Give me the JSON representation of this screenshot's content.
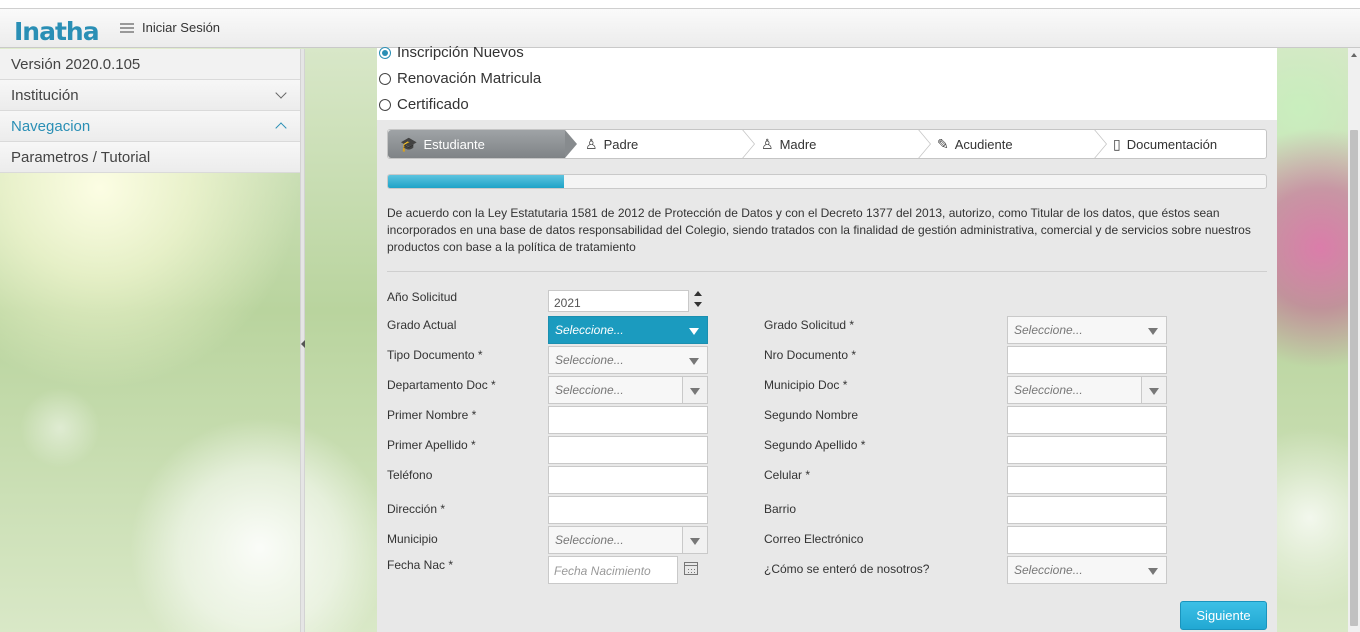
{
  "app": {
    "logo": "Inatha",
    "menu_label": "Iniciar Sesión"
  },
  "sidebar": {
    "version": "Versión 2020.0.105",
    "items": [
      {
        "label": "Institución",
        "expanded": false
      },
      {
        "label": "Navegacion",
        "expanded": true
      },
      {
        "label": "Parametros / Tutorial"
      }
    ]
  },
  "options": [
    {
      "label": "Inscripción Nuevos",
      "checked": true
    },
    {
      "label": "Renovación Matricula",
      "checked": false
    },
    {
      "label": "Certificado",
      "checked": false
    }
  ],
  "wizard": {
    "steps": [
      {
        "label": "Estudiante",
        "icon": "graduation-cap-icon",
        "active": true
      },
      {
        "label": "Padre",
        "icon": "user-icon"
      },
      {
        "label": "Madre",
        "icon": "user-icon"
      },
      {
        "label": "Acudiente",
        "icon": "pencil-icon"
      },
      {
        "label": "Documentación",
        "icon": "document-icon"
      }
    ],
    "progress_percent": 20
  },
  "disclaimer": "De acuerdo con la Ley Estatutaria 1581 de 2012 de Protección de Datos y con el Decreto 1377 del 2013, autorizo, como Titular de los datos, que éstos sean incorporados en una base de datos responsabilidad del Colegio, siendo tratados con la finalidad de gestión administrativa, comercial y de servicios sobre nuestros productos con base a la política de tratamiento",
  "form": {
    "ano_solicitud": {
      "label": "Año Solicitud",
      "value": "2021"
    },
    "grado_actual": {
      "label": "Grado Actual",
      "value": "Seleccione..."
    },
    "grado_solicitud": {
      "label": "Grado Solicitud *",
      "value": "Seleccione..."
    },
    "tipo_documento": {
      "label": "Tipo Documento *",
      "value": "Seleccione..."
    },
    "nro_documento": {
      "label": "Nro Documento *"
    },
    "departamento_doc": {
      "label": "Departamento Doc *",
      "value": "Seleccione..."
    },
    "municipio_doc": {
      "label": "Municipio Doc *",
      "value": "Seleccione..."
    },
    "primer_nombre": {
      "label": "Primer Nombre *"
    },
    "segundo_nombre": {
      "label": "Segundo Nombre"
    },
    "primer_apellido": {
      "label": "Primer Apellido *"
    },
    "segundo_apellido": {
      "label": "Segundo Apellido *"
    },
    "telefono": {
      "label": "Teléfono"
    },
    "celular": {
      "label": "Celular *"
    },
    "direccion": {
      "label": "Dirección *"
    },
    "barrio": {
      "label": "Barrio"
    },
    "municipio": {
      "label": "Municipio",
      "value": "Seleccione..."
    },
    "correo": {
      "label": "Correo Electrónico"
    },
    "fecha_nac": {
      "label": "Fecha Nac *",
      "placeholder": "Fecha Nacimiento"
    },
    "como_se_entero": {
      "label": "¿Cómo se enteró de nosotros?",
      "value": "Seleccione..."
    }
  },
  "buttons": {
    "next": "Siguiente"
  },
  "colors": {
    "accent": "#1b9bbf",
    "brand": "#2a8fb5"
  }
}
